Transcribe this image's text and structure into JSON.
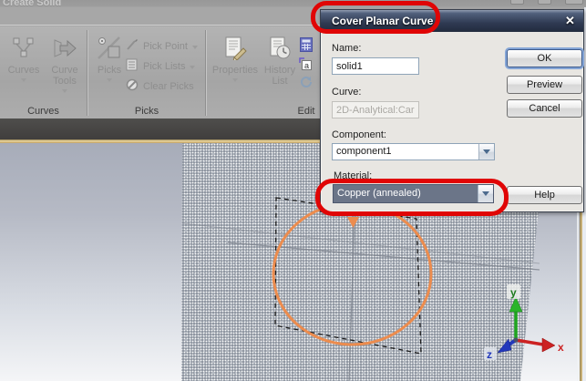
{
  "titlebar": {
    "caption": "Create Solid",
    "window_controls": [
      "minimize",
      "restore",
      "close"
    ]
  },
  "ribbon": {
    "groups": [
      {
        "label": "Curves",
        "buttons": [
          {
            "label": "Curves"
          },
          {
            "label": "Curve Tools"
          }
        ]
      },
      {
        "label": "Picks",
        "buttons": [
          {
            "label": "Picks"
          },
          {
            "label": "Pick Point"
          },
          {
            "label": "Pick Lists"
          },
          {
            "label": "Clear Picks"
          }
        ]
      },
      {
        "label": "Edit",
        "buttons": [
          {
            "label": "Properties"
          },
          {
            "label": "History List"
          }
        ]
      }
    ],
    "edit_icons": {
      "variable_glyph": "a"
    }
  },
  "dialog": {
    "title": "Cover Planar Curve",
    "close_glyph": "✕",
    "fields": {
      "name": {
        "label": "Name:",
        "value": "solid1"
      },
      "curve": {
        "label": "Curve:",
        "value": "2D-Analytical:Car"
      },
      "component": {
        "label": "Component:",
        "value": "component1"
      },
      "material": {
        "label": "Material:",
        "value": "Copper (annealed)"
      }
    },
    "buttons": {
      "ok": "OK",
      "preview": "Preview",
      "cancel": "Cancel",
      "help": "Help"
    }
  },
  "viewport": {
    "triad": {
      "x_label": "x",
      "y_label": "y",
      "z_label": "z"
    }
  },
  "annotations": {
    "highlight_color": "#e00505",
    "highlighted": [
      "dialog-title",
      "material-dropdown"
    ]
  },
  "colors": {
    "annotation_red": "#e00505",
    "selection_fill": "#6b7588",
    "curve_orange": "#ec8c4e",
    "axis_x_red": "#cc2222",
    "axis_y_green": "#1fa51f",
    "axis_z_blue": "#2238bb",
    "tan_strip": "#d9bd82"
  }
}
